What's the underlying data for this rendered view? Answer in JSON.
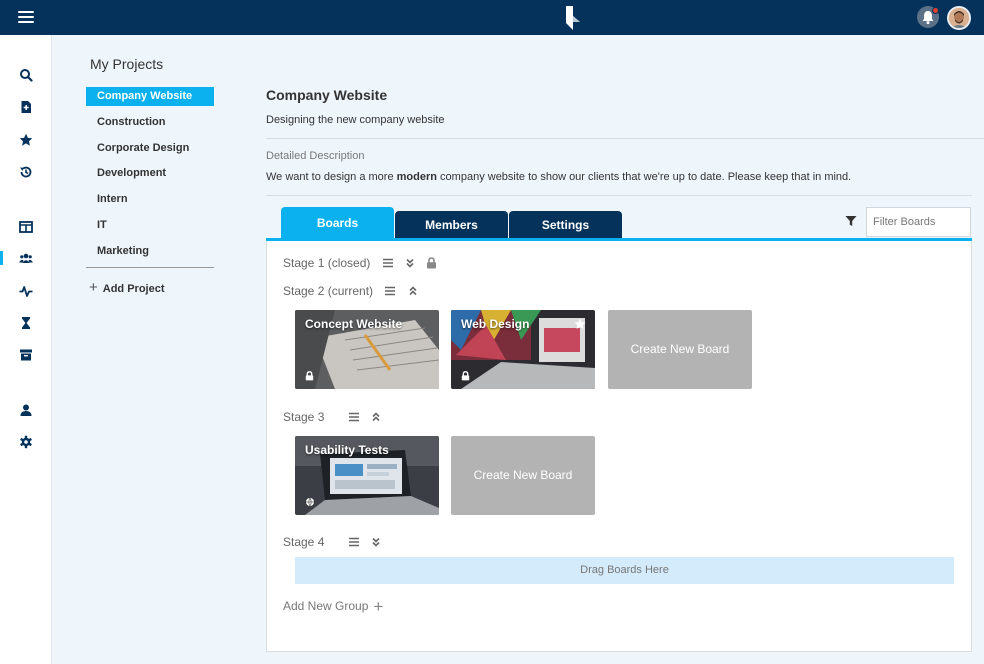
{
  "topbar": {
    "menu_icon": "hamburger-icon",
    "logo_icon": "app-logo",
    "notifications_icon": "bell-icon",
    "avatar_icon": "user-avatar"
  },
  "rail": {
    "icons": [
      "search-icon",
      "new-document-icon",
      "star-icon",
      "history-icon",
      "boards-icon",
      "team-icon",
      "activity-icon",
      "hourglass-icon",
      "archive-icon",
      "user-icon",
      "gear-icon"
    ],
    "active": "team-icon"
  },
  "projects": {
    "title": "My Projects",
    "items": [
      "Company Website",
      "Construction",
      "Corporate Design",
      "Development",
      "Intern",
      "IT",
      "Marketing"
    ],
    "active": "Company Website",
    "add_label": "Add Project"
  },
  "main": {
    "title": "Company Website",
    "subtitle": "Designing the new company website",
    "desc_label": "Detailed Description",
    "desc_before": "We want to design a more ",
    "desc_bold": "modern",
    "desc_after": " company website to show our clients that we're up to date. Please keep that in mind."
  },
  "tabs": [
    "Boards",
    "Members",
    "Settings"
  ],
  "active_tab": "Boards",
  "filter": {
    "placeholder": "Filter Boards"
  },
  "stages": [
    {
      "label": "Stage 1 (closed)"
    },
    {
      "label": "Stage 2 (current)"
    },
    {
      "label": "Stage 3"
    },
    {
      "label": "Stage 4"
    }
  ],
  "boards": [
    {
      "title": "Concept Website",
      "private": true
    },
    {
      "title": "Web Design",
      "private": true,
      "starred": true
    },
    {
      "title": "Usability Tests",
      "public": true
    }
  ],
  "create_board_label": "Create New Board",
  "drop_zone_label": "Drag Boards Here",
  "add_group_label": "Add New Group",
  "colors": {
    "navy": "#04325a",
    "accent": "#0ab1ee",
    "placeholder_board": "#b3b3b3",
    "drop_zone": "#d4ebfc"
  }
}
